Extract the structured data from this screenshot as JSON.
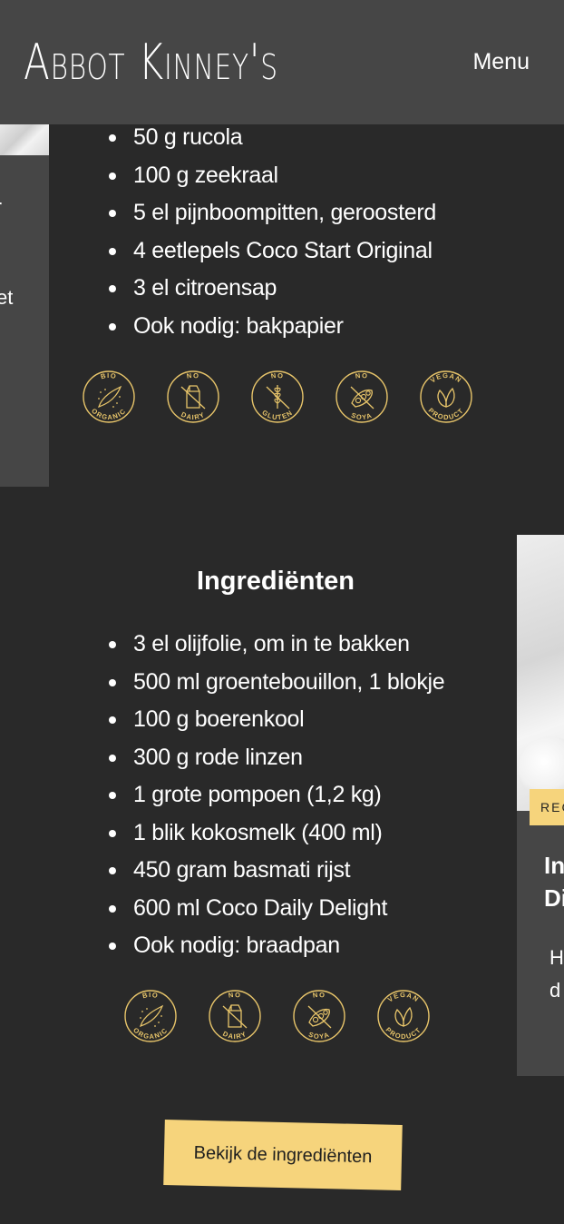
{
  "header": {
    "logo_text": "Abbot Kinney's",
    "menu_label": "Menu"
  },
  "left_card": {
    "fragment_1": "r",
    "fragment_2": "et"
  },
  "section1": {
    "items": [
      "50 g rucola",
      "100 g zeekraal",
      "5 el pijnboompitten, geroosterd",
      "4 eetlepels Coco Start Original",
      "3 el citroensap",
      "Ook nodig: bakpapier"
    ],
    "badges": [
      {
        "top": "BIO",
        "bottom": "ORGANIC",
        "icon": "leaf-stars-icon"
      },
      {
        "top": "NO",
        "bottom": "DAIRY",
        "icon": "milk-carton-icon"
      },
      {
        "top": "NO",
        "bottom": "GLUTEN",
        "icon": "wheat-icon"
      },
      {
        "top": "NO",
        "bottom": "SOYA",
        "icon": "soybean-icon"
      },
      {
        "top": "VEGAN",
        "bottom": "PRODUCT",
        "icon": "vegan-leaf-icon"
      }
    ]
  },
  "section2": {
    "title": "Ingrediënten",
    "items": [
      "3 el olijfolie, om in te bakken",
      "500 ml groentebouillon, 1 blokje",
      "100 g boerenkool",
      "300 g rode linzen",
      "1 grote pompoen (1,2 kg)",
      "1 blik kokosmelk (400 ml)",
      "450 gram basmati rijst",
      "600 ml Coco Daily Delight",
      "Ook nodig: braadpan"
    ],
    "badges": [
      {
        "top": "BIO",
        "bottom": "ORGANIC",
        "icon": "leaf-stars-icon"
      },
      {
        "top": "NO",
        "bottom": "DAIRY",
        "icon": "milk-carton-icon"
      },
      {
        "top": "NO",
        "bottom": "SOYA",
        "icon": "soybean-icon"
      },
      {
        "top": "VEGAN",
        "bottom": "PRODUCT",
        "icon": "vegan-leaf-icon"
      }
    ]
  },
  "right_card": {
    "tag": "REC",
    "title_line1": "In",
    "title_line2": "Di",
    "desc_line1": "H",
    "desc_line2": "d"
  },
  "cta": {
    "label": "Bekijk de ingrediënten"
  },
  "colors": {
    "background": "#292929",
    "header": "#464646",
    "card": "#464646",
    "accent": "#f6d47c",
    "badge_line": "#e8c56a",
    "text": "#ffffff"
  }
}
